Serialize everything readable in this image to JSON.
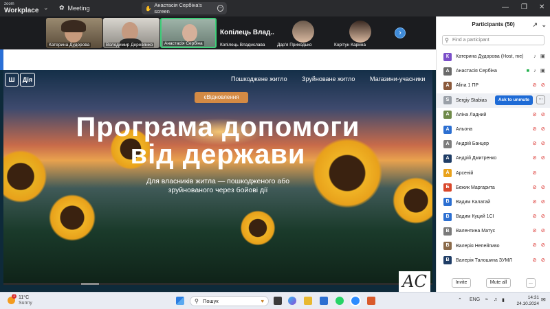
{
  "titlebar": {
    "app_small": "zoom",
    "app_big": "Workplace",
    "meeting_label": "Meeting",
    "share_label": "Анастасія Сербіна's screen"
  },
  "video_strip": {
    "tiles": [
      {
        "name": "Катерина Дудорова"
      },
      {
        "name": "Володимир Деревянко"
      },
      {
        "name": "Анастасія Сербіна"
      },
      {
        "name": "Копілець Владислава"
      },
      {
        "name": "Дар'я Приходько"
      },
      {
        "name": "Корітун Карина"
      }
    ],
    "big_name": "Копілець Влад..."
  },
  "shared_page": {
    "logo_left": "Ш",
    "logo_right": "Дія",
    "nav": [
      "Пошкоджене житло",
      "Зруйноване житло",
      "Магазини-учасники"
    ],
    "pill": "єВідновлення",
    "headline_1": "Програма допомоги",
    "headline_2": "від держави",
    "subtitle_1": "Для власників житла — пошкодженого або",
    "subtitle_2": "зруйнованого через бойові дії",
    "watermark": "AC"
  },
  "participants": {
    "title": "Participants (50)",
    "search_placeholder": "Find a participant",
    "ask_label": "Ask to unmute",
    "list": [
      {
        "name": "Катерина Дудорова (Host, me)",
        "avatar": "К",
        "color": "#7b4fc9",
        "state": "host"
      },
      {
        "name": "Анастасія Сербіна",
        "avatar": "А",
        "color": "#6a6a6a",
        "state": "sharing"
      },
      {
        "name": "Alina 1 ПР",
        "avatar": "A",
        "color": "#8b5a3c",
        "state": "muted"
      },
      {
        "name": "Sergiy Stabias",
        "avatar": "S",
        "color": "#9aa0a8",
        "state": "ask"
      },
      {
        "name": "Аліна Ладний",
        "avatar": "А",
        "color": "#6f8a4a",
        "state": "muted"
      },
      {
        "name": "Альона",
        "avatar": "А",
        "color": "#2c6fd1",
        "state": "muted"
      },
      {
        "name": "Андрій Банцер",
        "avatar": "А",
        "color": "#7d7d7d",
        "state": "muted"
      },
      {
        "name": "Андрій Дмитренко",
        "avatar": "А",
        "color": "#1f3d66",
        "state": "muted"
      },
      {
        "name": "Арсеній",
        "avatar": "А",
        "color": "#e9a21b",
        "state": "muted_only"
      },
      {
        "name": "Бежик Маргарита",
        "avatar": "Б",
        "color": "#d9482b",
        "state": "muted"
      },
      {
        "name": "Вадим Калатай",
        "avatar": "В",
        "color": "#2c6fd1",
        "state": "muted"
      },
      {
        "name": "Вадим Куций 1СІ",
        "avatar": "В",
        "color": "#2c6fd1",
        "state": "muted"
      },
      {
        "name": "Валентина Матус",
        "avatar": "В",
        "color": "#7a7a7a",
        "state": "muted"
      },
      {
        "name": "Валерія Непейпиво",
        "avatar": "В",
        "color": "#8a6a4a",
        "state": "muted"
      },
      {
        "name": "Валерія Талошина ЗУМЛ",
        "avatar": "В",
        "color": "#1f3d66",
        "state": "muted"
      }
    ],
    "invite_label": "Invite",
    "mute_all_label": "Mute all",
    "more_label": "..."
  },
  "taskbar": {
    "temp": "11°C",
    "weather": "Sunny",
    "badge": "1",
    "search_label": "Пошук",
    "lang": "ENG",
    "time": "14:31",
    "date": "24.10.2024"
  },
  "colors": {
    "accent_blue": "#1e6bd6",
    "muted_red": "#d9302c",
    "pill_orange": "#d38a44"
  }
}
